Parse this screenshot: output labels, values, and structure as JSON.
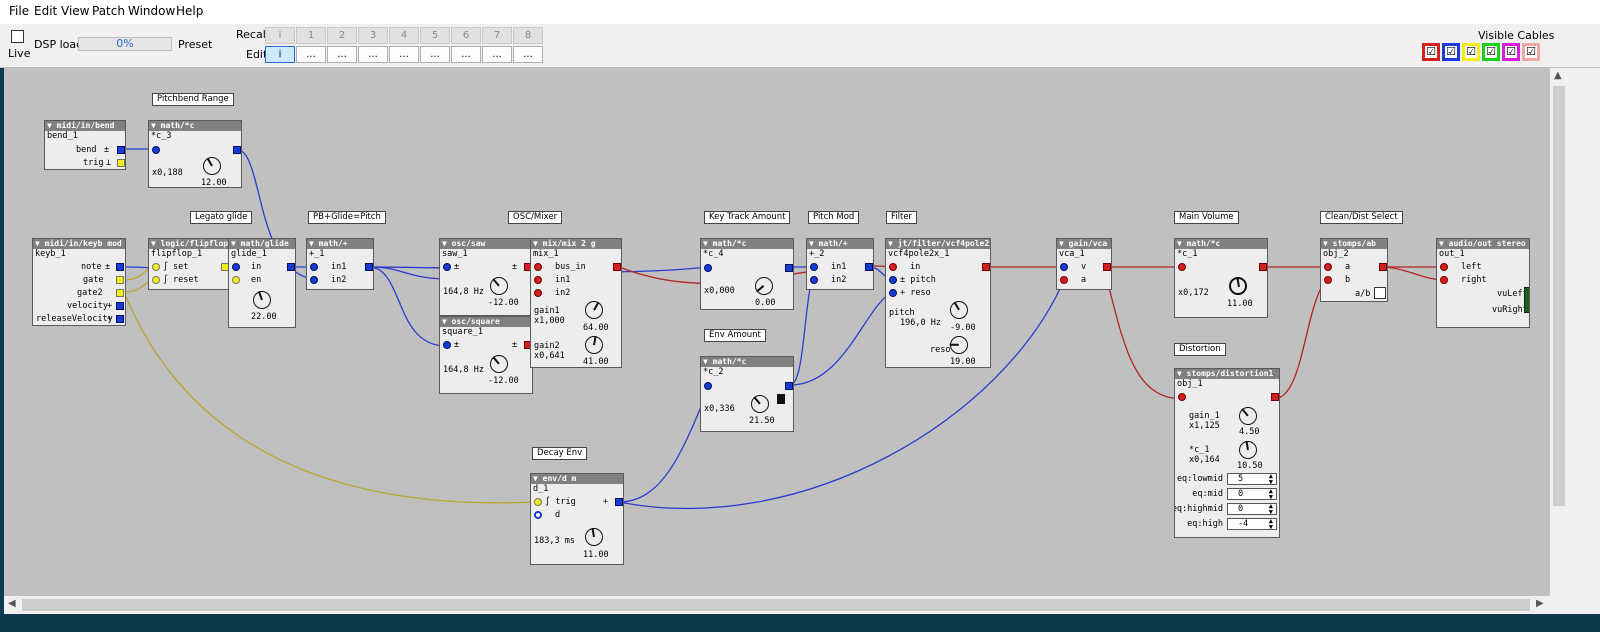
{
  "menu": [
    "File",
    "Edit",
    "View",
    "Patch",
    "Window",
    "Help"
  ],
  "toolbar": {
    "live": "Live",
    "dsp_load": "DSP load",
    "dsp_value": "0%",
    "preset": "Preset",
    "recall": "Recall",
    "edit": "Edit",
    "recall_buttons": [
      "i",
      "1",
      "2",
      "3",
      "4",
      "5",
      "6",
      "7",
      "8"
    ],
    "edit_buttons": [
      "i",
      "...",
      "...",
      "...",
      "...",
      "...",
      "...",
      "...",
      "..."
    ],
    "visible_cables": "Visible Cables",
    "cable_colors": [
      "#d21f1f",
      "#1a3ad6",
      "#f2ee18",
      "#19d119",
      "#d41fd4",
      "#f4a5a5"
    ]
  },
  "comments": {
    "pitchbend_range": "Pitchbend Range",
    "legato_glide": "Legato glide",
    "pb_glide_pitch": "PB+Glide=Pitch",
    "osc_mixer": "OSC/Mixer",
    "key_track": "Key Track Amount",
    "pitch_mod": "Pitch Mod",
    "filter": "Filter",
    "main_volume": "Main Volume",
    "clean_dist": "Clean/Dist Select",
    "env_amount": "Env Amount",
    "decay_env": "Decay Env",
    "distortion": "Distortion"
  },
  "objects": {
    "bend": {
      "type": "midi/in/bend",
      "name": "bend_1",
      "o1": "bend",
      "o2": "trig"
    },
    "c3": {
      "type": "math/*c",
      "name": "*c_3",
      "value": "x0,188",
      "knob": "12.00"
    },
    "keyb": {
      "type": "midi/in/keyb mod",
      "name": "keyb_1",
      "o1": "note",
      "o2": "gate",
      "o3": "gate2",
      "o4": "velocity",
      "o5": "releaseVelocity"
    },
    "flipflop": {
      "type": "logic/flipflop",
      "name": "flipflop_1",
      "i1": "set",
      "i2": "reset"
    },
    "glide": {
      "type": "math/glide",
      "name": "glide_1",
      "i1": "in",
      "i2": "en",
      "knob": "22.00"
    },
    "plus1": {
      "type": "math/+",
      "name": "+_1",
      "i1": "in1",
      "i2": "in2"
    },
    "saw": {
      "type": "osc/saw",
      "name": "saw_1",
      "freq": "164,8 Hz",
      "knob": "-12.00"
    },
    "square": {
      "type": "osc/square",
      "name": "square_1",
      "freq": "164,8 Hz",
      "knob": "-12.00"
    },
    "mix": {
      "type": "mix/mix 2 g",
      "name": "mix_1",
      "i1": "bus_in",
      "i2": "in1",
      "i3": "in2",
      "g1": "gain1",
      "g1v": "x1,000",
      "k1": "64.00",
      "g2": "gain2",
      "g2v": "x0,641",
      "k2": "41.00"
    },
    "c4": {
      "type": "math/*c",
      "name": "*c_4",
      "value": "x0,000",
      "knob": "0.00"
    },
    "plus2": {
      "type": "math/+",
      "name": "+_2",
      "i1": "in1",
      "i2": "in2"
    },
    "vcf": {
      "type": "jt/filter/vcf4pole2x",
      "name": "vcf4pole2x_1",
      "i1": "in",
      "i2": "pitch",
      "i3": "reso",
      "p": "pitch",
      "pv": "196,0 Hz",
      "k1": "-9.00",
      "r": "reso",
      "k2": "19.00"
    },
    "vca": {
      "type": "gain/vca",
      "name": "vca_1",
      "i1": "v",
      "i2": "a"
    },
    "c1": {
      "type": "math/*c",
      "name": "*c_1",
      "value": "x0,172",
      "knob": "11.00"
    },
    "ab": {
      "type": "stomps/ab",
      "name": "obj_2",
      "i1": "a",
      "i2": "b",
      "t": "a/b"
    },
    "out": {
      "type": "audio/out stereo",
      "name": "out_1",
      "i1": "left",
      "i2": "right",
      "o1": "vuLeft",
      "o2": "vuRight"
    },
    "c2": {
      "type": "math/*c",
      "name": "*c_2",
      "value": "x0,336",
      "knob": "21.50"
    },
    "env": {
      "type": "env/d m",
      "name": "d_1",
      "i1": "trig",
      "i2": "d",
      "time": "183,3 ms",
      "knob": "11.00"
    },
    "dist": {
      "type": "stomps/distortion1",
      "name": "obj_1",
      "g": "gain_1",
      "gv": "x1,125",
      "k1": "4.50",
      "c": "*c_1",
      "cv": "x0,164",
      "k2": "10.50",
      "eq": [
        {
          "label": "eq:lowmid",
          "value": "5"
        },
        {
          "label": "eq:mid",
          "value": "0"
        },
        {
          "label": "eq:highmid",
          "value": "0"
        },
        {
          "label": "eq:high",
          "value": "-4"
        }
      ]
    }
  }
}
